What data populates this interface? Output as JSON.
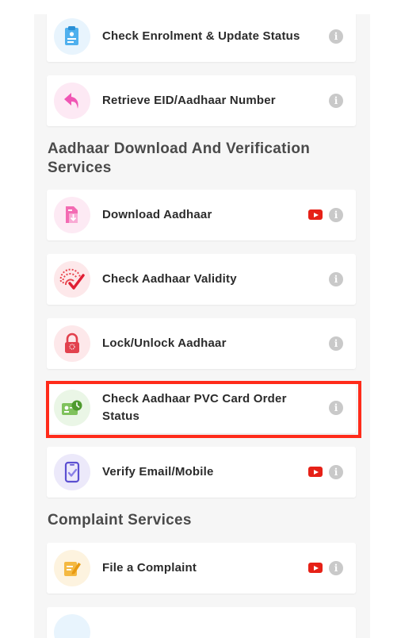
{
  "top_items": [
    {
      "label": "Check Enrolment & Update Status",
      "icon": "document-form-icon",
      "has_video": false
    },
    {
      "label": "Retrieve EID/Aadhaar Number",
      "icon": "retrieve-arrow-icon",
      "has_video": false
    }
  ],
  "sections": {
    "download": {
      "title": "Aadhaar Download And Verification Services"
    },
    "complaint": {
      "title": "Complaint Services"
    }
  },
  "download_items": [
    {
      "label": "Download Aadhaar",
      "icon": "download-document-icon",
      "has_video": true
    },
    {
      "label": "Check Aadhaar Validity",
      "icon": "aadhaar-check-icon",
      "has_video": false
    },
    {
      "label": "Lock/Unlock Aadhaar",
      "icon": "lock-icon",
      "has_video": false
    },
    {
      "label": "Check Aadhaar PVC Card Order Status",
      "icon": "pvc-card-icon",
      "has_video": false
    },
    {
      "label": "Verify Email/Mobile",
      "icon": "mobile-verify-icon",
      "has_video": true
    }
  ],
  "complaint_items": [
    {
      "label": "File a Complaint",
      "icon": "edit-note-icon",
      "has_video": true
    }
  ],
  "info_glyph": "i",
  "colors": {
    "highlight": "#ff2b1a",
    "youtube": "#e62117",
    "info": "#c9c9c9"
  }
}
